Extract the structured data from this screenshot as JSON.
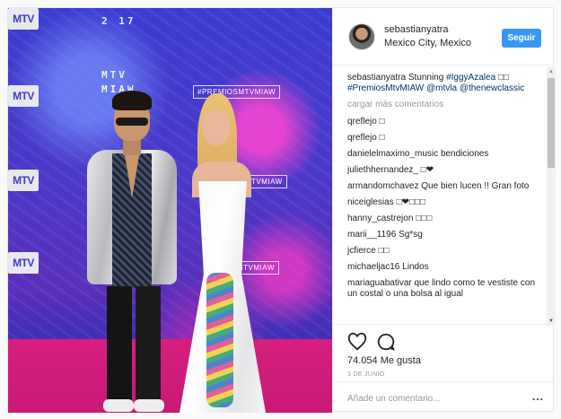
{
  "photo": {
    "wall_year": "2   17",
    "wall_miaw_top": "MTV",
    "wall_miaw_bottom": "MIAW",
    "wall_hashtag": "#PREMIOSMTVMIAW",
    "wall_hashtag_2": "TVMIAW",
    "wall_hashtag_3": "MTVMIAW",
    "mtv_logo": "MTV"
  },
  "header": {
    "username": "sebastianyatra",
    "location": "Mexico City, Mexico",
    "follow_label": "Seguir"
  },
  "caption": {
    "author": "sebastianyatra",
    "text_plain": " Stunning ",
    "mention_1": "#IggyAzalea",
    "emoji_1": " □□",
    "hashtag": "#PremiosMtvMIAW",
    "mention_2": "@mtvla",
    "mention_3": "@thenewclassic"
  },
  "load_more": "cargar más comentarios",
  "comments": [
    {
      "author": "qreflejo",
      "text": "□"
    },
    {
      "author": "qreflejo",
      "text": "□"
    },
    {
      "author": "danielelmaximo_music",
      "text": "bendiciones"
    },
    {
      "author": "juliethhernandez_",
      "text": "□❤"
    },
    {
      "author": "armandomchavez",
      "text": "Que bien lucen !! Gran foto"
    },
    {
      "author": "niceiglesias",
      "text": "□❤□□□"
    },
    {
      "author": "hanny_castrejon",
      "text": "□□□"
    },
    {
      "author": "marii__1196",
      "text": "Sg*sg"
    },
    {
      "author": "jcfierce",
      "text": "□□"
    },
    {
      "author": "michaeljac16",
      "text": "Lindos"
    },
    {
      "author": "mariaguabativar",
      "text": "que lindo como te vestiste con un costal o una bolsa al igual"
    }
  ],
  "actions": {
    "likes": "74.054 Me gusta",
    "date": "3 DE JUNIO",
    "heart_icon": "heart-icon",
    "comment_icon": "comment-icon"
  },
  "add_comment": {
    "placeholder": "Añade un comentario..."
  },
  "more_label": "..."
}
